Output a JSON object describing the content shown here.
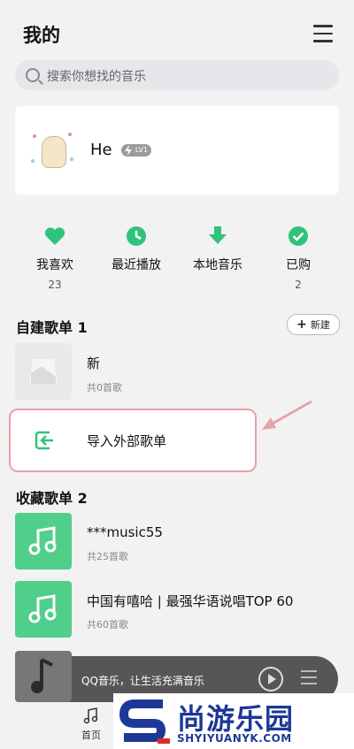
{
  "header": {
    "title": "我的"
  },
  "search": {
    "placeholder": "搜索你想找的音乐"
  },
  "profile": {
    "name": "He",
    "level": "LV1"
  },
  "quick": [
    {
      "label": "我喜欢",
      "count": "23"
    },
    {
      "label": "最近播放",
      "count": ""
    },
    {
      "label": "本地音乐",
      "count": ""
    },
    {
      "label": "已购",
      "count": "2"
    }
  ],
  "created": {
    "title": "自建歌单 1",
    "new_label": "新建",
    "items": [
      {
        "name": "新",
        "sub": "共0首歌"
      }
    ],
    "import_label": "导入外部歌单"
  },
  "collected": {
    "title": "收藏歌单 2",
    "items": [
      {
        "name": "***music55",
        "sub": "共25首歌"
      },
      {
        "name": "中国有嘻哈 | 最强华语说唱TOP 60",
        "sub": "共60首歌"
      }
    ]
  },
  "player": {
    "text": "QQ音乐，让生活充满音乐"
  },
  "nav": {
    "home": "首页"
  },
  "watermark": {
    "text": "尚游乐园",
    "sub": "SHYIYUANYK.COM"
  },
  "colors": {
    "accent": "#31c27c",
    "highlight": "#e7a3a6",
    "watermark": "#1d3897"
  }
}
